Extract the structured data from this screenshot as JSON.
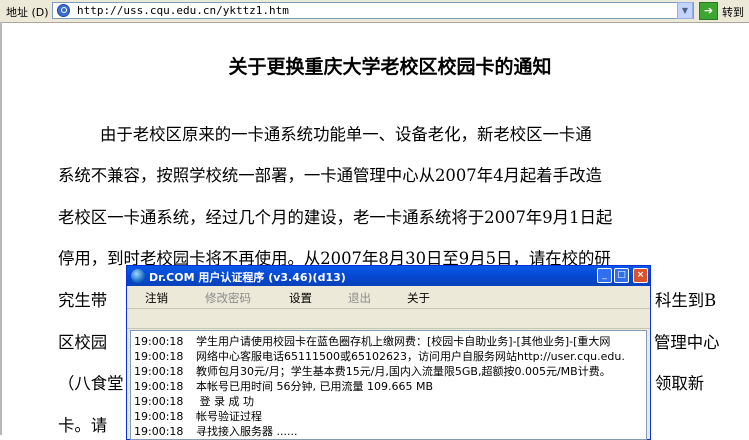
{
  "browser": {
    "address_label": "地址 (D)",
    "url": "http://uss.cqu.edu.cn/ykttz1.htm",
    "go_label": "转到"
  },
  "document": {
    "title": "关于更换重庆大学老校区校园卡的通知",
    "lines": [
      "由于老校区原来的一卡通系统功能单一、设备老化，新老校区一卡通",
      "系统不兼容，按照学校统一部署，一卡通管理中心从2007年4月起着手改造",
      "老校区一卡通系统，经过几个月的建设，老一卡通系统将于2007年9月1日起",
      "停用，到时老校园卡将不再使用。从2007年8月30日至9月5日，请在校的研",
      "究生带",
      "科生到B",
      "区校园",
      "管理中心",
      "（八食堂",
      "领取新",
      "卡。请"
    ]
  },
  "client": {
    "title": "Dr.COM 用户认证程序 (v3.46)(d13)",
    "menu": {
      "logout": "注销",
      "change_password": "修改密码",
      "settings": "设置",
      "exit": "退出",
      "about": "关于"
    },
    "log": [
      {
        "time": "19:00:18",
        "text": "学生用户请使用校园卡在蓝色圈存机上缴网费：[校园卡自助业务]-[其他业务]-[重大网"
      },
      {
        "time": "19:00:18",
        "text": "网络中心客服电话65111500或65102623，访问用户自服务网站http://user.cqu.edu."
      },
      {
        "time": "19:00:18",
        "text": "教师包月30元/月；学生基本费15元/月,国内入流量限5GB,超额按0.005元/MB计费。"
      },
      {
        "time": "19:00:18",
        "text": "本帐号已用时间 56分钟, 已用流量 109.665 MB"
      },
      {
        "time": "19:00:18",
        "text": " 登 录 成 功"
      },
      {
        "time": "19:00:18",
        "text": "帐号验证过程"
      },
      {
        "time": "19:00:18",
        "text": "寻找接入服务器 ......"
      }
    ]
  }
}
